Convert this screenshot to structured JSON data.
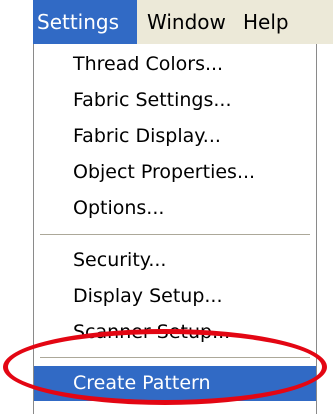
{
  "menubar": {
    "items": [
      {
        "label": "Settings",
        "active": true
      },
      {
        "label": "Window",
        "active": false
      },
      {
        "label": "Help",
        "active": false
      }
    ]
  },
  "dropdown": {
    "groups": [
      [
        "Thread Colors...",
        "Fabric Settings...",
        "Fabric Display...",
        "Object Properties...",
        "Options..."
      ],
      [
        "Security...",
        "Display Setup...",
        "Scanner Setup..."
      ],
      [
        "Create Pattern"
      ]
    ],
    "highlighted_item": "Create Pattern"
  },
  "colors": {
    "highlight": "#316ac5",
    "menubar_bg": "#ece9d8",
    "annotation_ring": "#e30613"
  }
}
